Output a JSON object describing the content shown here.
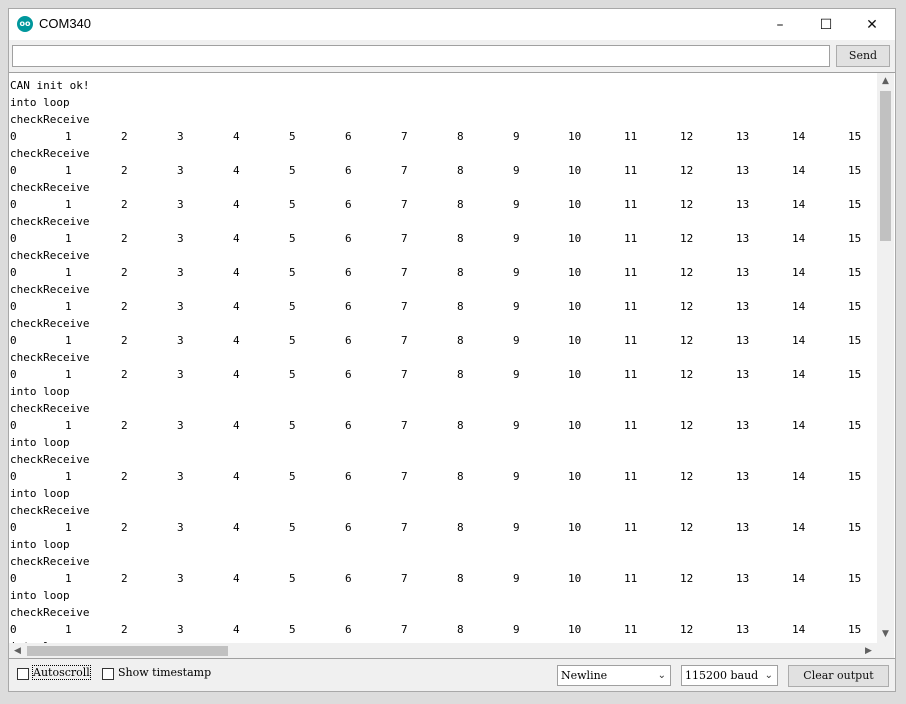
{
  "window": {
    "title": "COM340",
    "icon": "arduino-icon",
    "controls": {
      "minimize": "–",
      "maximize": "☐",
      "close": "✕"
    }
  },
  "send_bar": {
    "input_value": "",
    "send_label": "Send"
  },
  "output": {
    "column_numbers": [
      "0",
      "1",
      "2",
      "3",
      "4",
      "5",
      "6",
      "7",
      "8",
      "9",
      "10",
      "11",
      "12",
      "13",
      "14",
      "15"
    ],
    "lines": [
      {
        "type": "text",
        "text": "CAN init ok!"
      },
      {
        "type": "text",
        "text": "into loop"
      },
      {
        "type": "text",
        "text": "checkReceive"
      },
      {
        "type": "numbers"
      },
      {
        "type": "text",
        "text": "checkReceive"
      },
      {
        "type": "numbers"
      },
      {
        "type": "text",
        "text": "checkReceive"
      },
      {
        "type": "numbers"
      },
      {
        "type": "text",
        "text": "checkReceive"
      },
      {
        "type": "numbers"
      },
      {
        "type": "text",
        "text": "checkReceive"
      },
      {
        "type": "numbers"
      },
      {
        "type": "text",
        "text": "checkReceive"
      },
      {
        "type": "numbers"
      },
      {
        "type": "text",
        "text": "checkReceive"
      },
      {
        "type": "numbers"
      },
      {
        "type": "text",
        "text": "checkReceive"
      },
      {
        "type": "numbers"
      },
      {
        "type": "text",
        "text": "into loop"
      },
      {
        "type": "text",
        "text": "checkReceive"
      },
      {
        "type": "numbers"
      },
      {
        "type": "text",
        "text": "into loop"
      },
      {
        "type": "text",
        "text": "checkReceive"
      },
      {
        "type": "numbers"
      },
      {
        "type": "text",
        "text": "into loop"
      },
      {
        "type": "text",
        "text": "checkReceive"
      },
      {
        "type": "numbers"
      },
      {
        "type": "text",
        "text": "into loop"
      },
      {
        "type": "text",
        "text": "checkReceive"
      },
      {
        "type": "numbers"
      },
      {
        "type": "text",
        "text": "into loop"
      },
      {
        "type": "text",
        "text": "checkReceive"
      },
      {
        "type": "numbers"
      },
      {
        "type": "text",
        "text": "into loop"
      }
    ]
  },
  "footer": {
    "autoscroll_label": "Autoscroll",
    "autoscroll_checked": false,
    "timestamp_label": "Show timestamp",
    "timestamp_checked": false,
    "line_ending": "Newline",
    "baud_rate": "115200 baud",
    "clear_label": "Clear output"
  }
}
